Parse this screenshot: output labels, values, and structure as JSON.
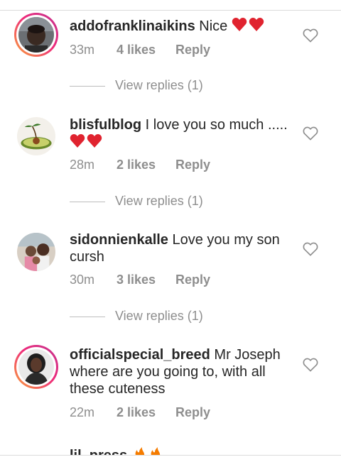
{
  "comments": [
    {
      "username": "addofranklinaikins",
      "text": " Nice",
      "emoji": "heart-heart",
      "time": "33m",
      "likes": "4 likes",
      "reply": "Reply",
      "view_replies": "View replies (1)",
      "story_ring": true
    },
    {
      "username": "blisfulblog",
      "text": " I love you so much .....",
      "emoji": "heart-heart",
      "time": "28m",
      "likes": "2 likes",
      "reply": "Reply",
      "view_replies": "View replies (1)",
      "story_ring": false
    },
    {
      "username": "sidonnienkalle",
      "text": " Love you my son cursh",
      "time": "30m",
      "likes": "3 likes",
      "reply": "Reply",
      "view_replies": "View replies (1)",
      "story_ring": false
    },
    {
      "username": "officialspecial_breed",
      "text": " Mr Joseph where are you going to, with all these cuteness",
      "time": "22m",
      "likes": "2 likes",
      "reply": "Reply",
      "story_ring": true
    }
  ],
  "partial_comment": {
    "username": "lil_press",
    "emoji": "fire-fire"
  },
  "colors": {
    "text": "#262626",
    "secondary": "#8e8e8e",
    "heart": "#e0232f",
    "fire": "#f57c00",
    "ring_start": "#f9a43a",
    "ring_end": "#c1358f"
  }
}
